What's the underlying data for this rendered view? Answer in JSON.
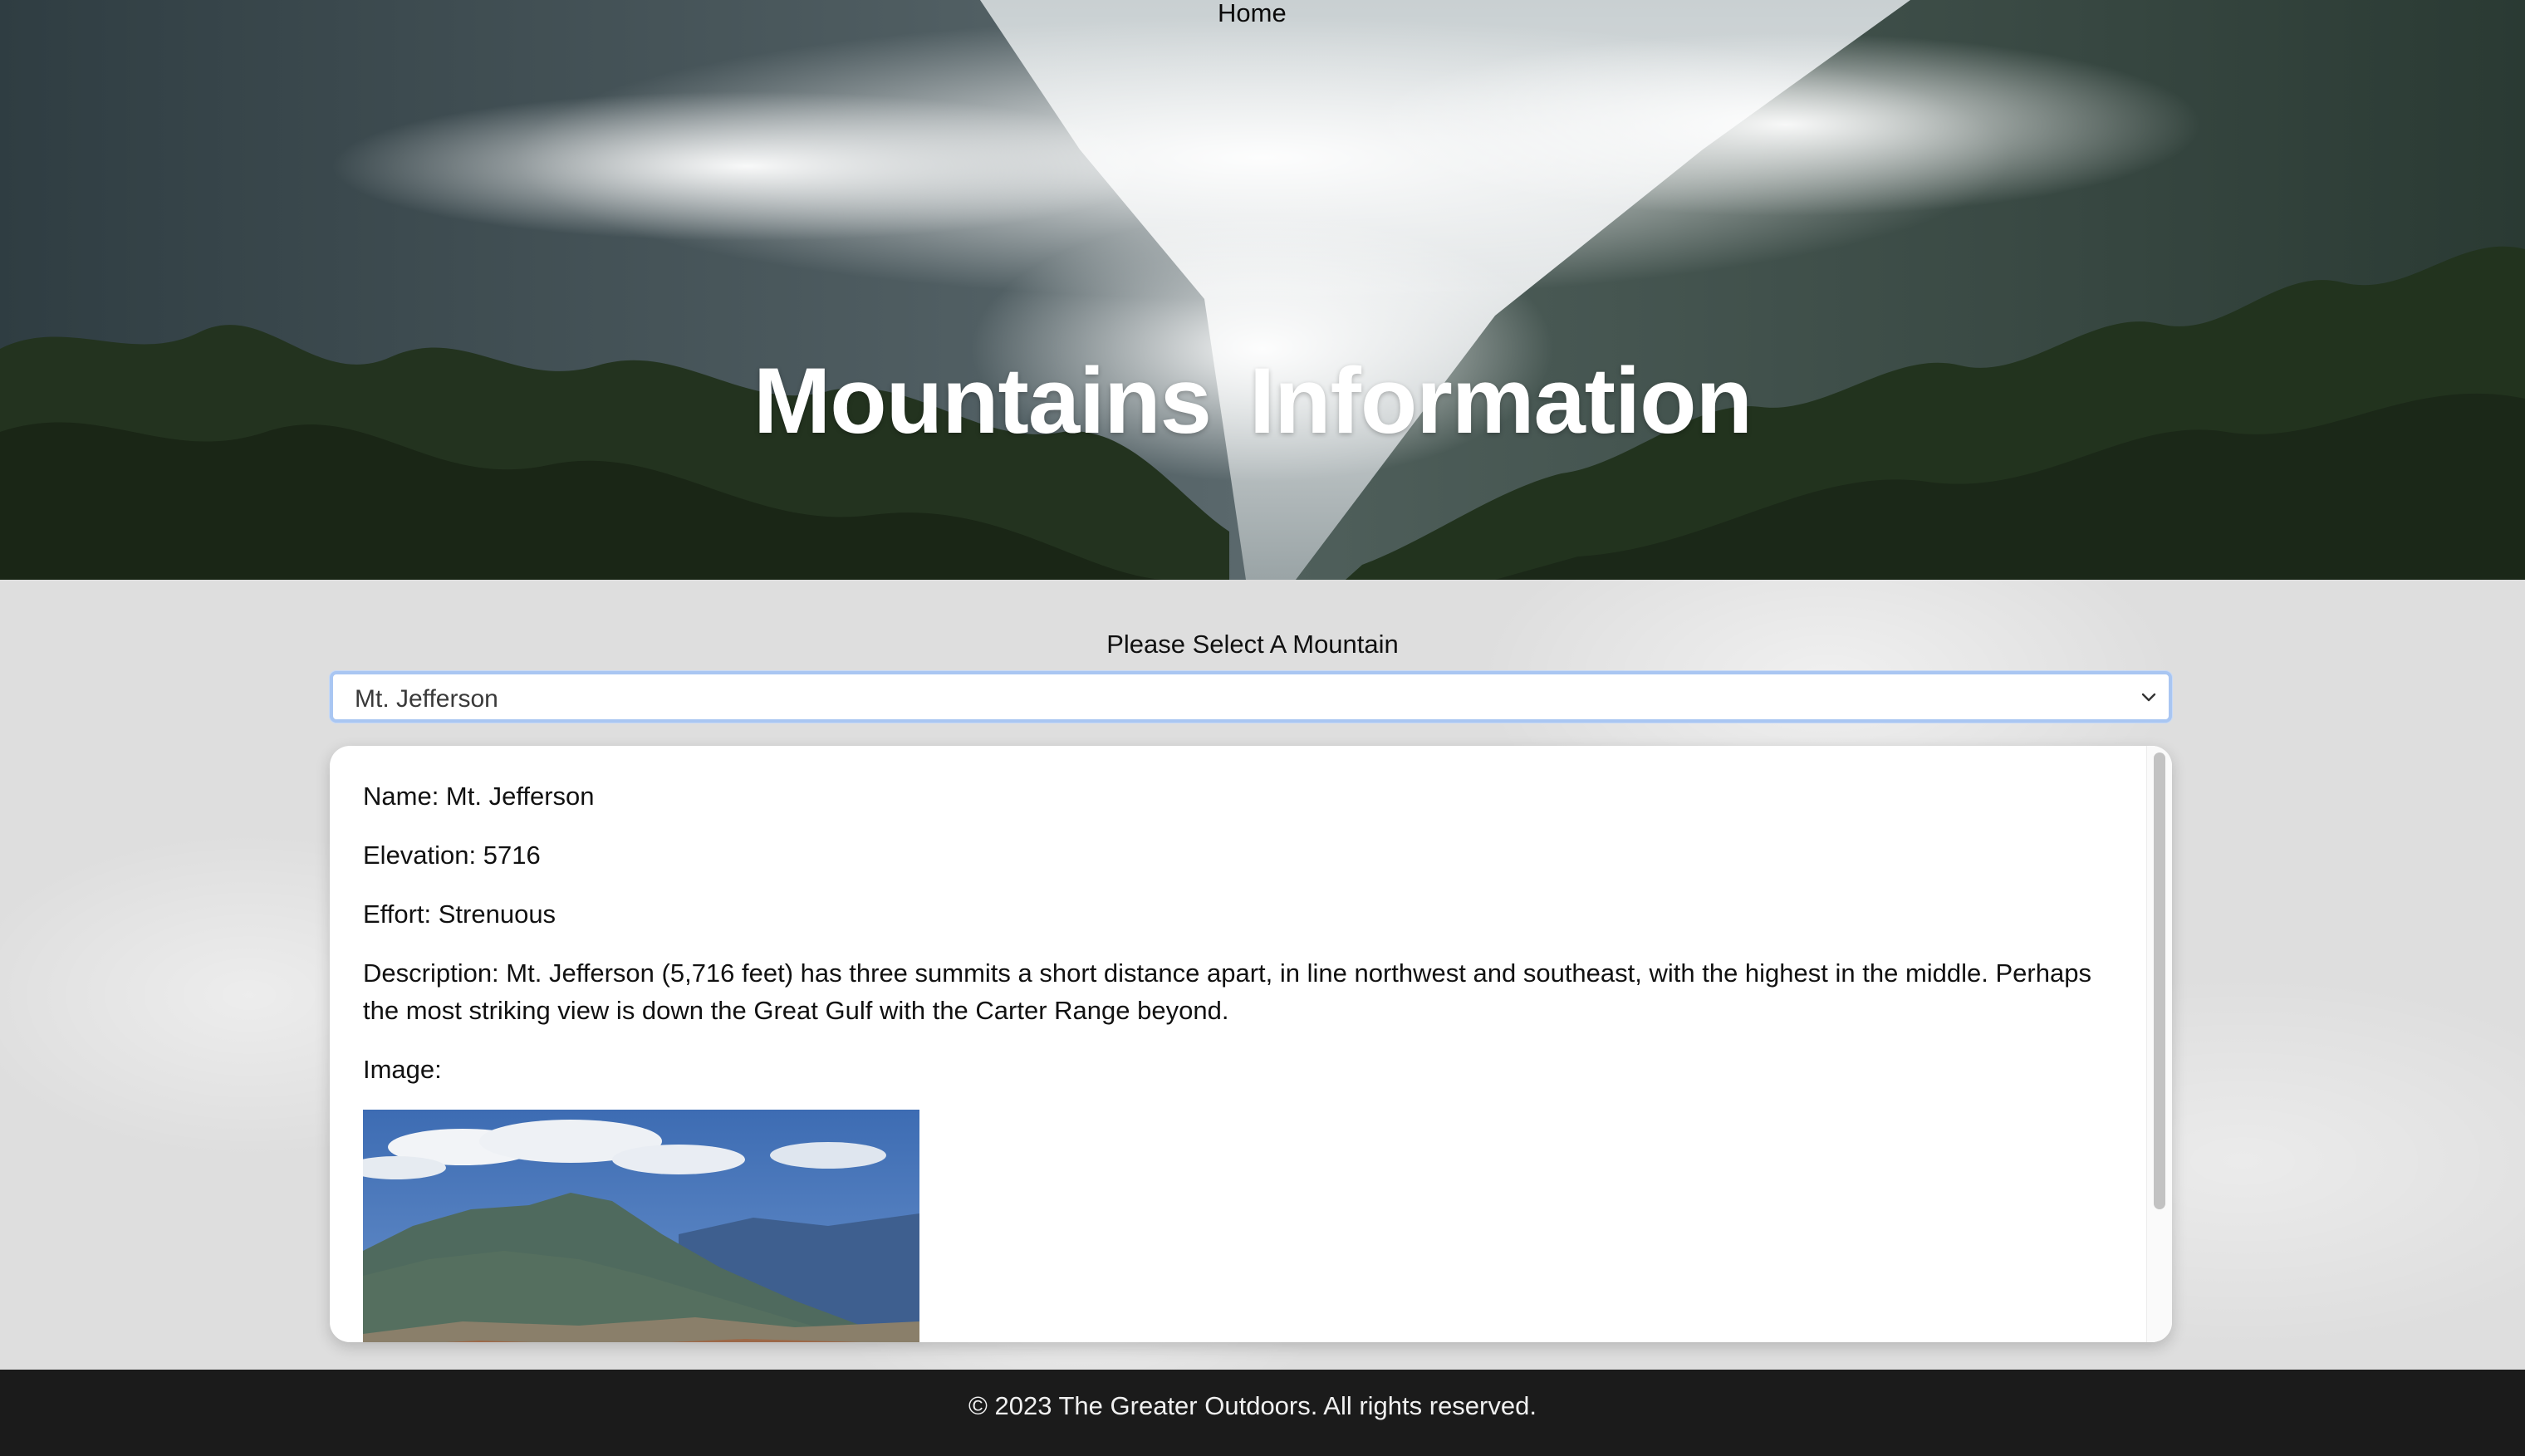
{
  "nav": {
    "home_label": "Home"
  },
  "hero": {
    "title": "Mountains Information"
  },
  "selector": {
    "label": "Please Select A Mountain",
    "selected_value": "Mt. Jefferson"
  },
  "details": {
    "name": "Name: Mt. Jefferson",
    "elevation": "Elevation: 5716",
    "effort": "Effort: Strenuous",
    "description": "Description: Mt. Jefferson (5,716 feet) has three summits a short distance apart, in line northwest and southeast, with the highest in the middle. Perhaps the most striking view is down the Great Gulf with the Carter Range beyond.",
    "image_label": "Image:"
  },
  "footer": {
    "copyright": "© 2023 The Greater Outdoors. All rights reserved."
  },
  "colors": {
    "footer_bg": "#1b1b1b",
    "select_focus_border": "#a9c6f2",
    "page_bg": "#dedede"
  },
  "icons": {
    "select_chevron": "chevron-down-icon"
  }
}
